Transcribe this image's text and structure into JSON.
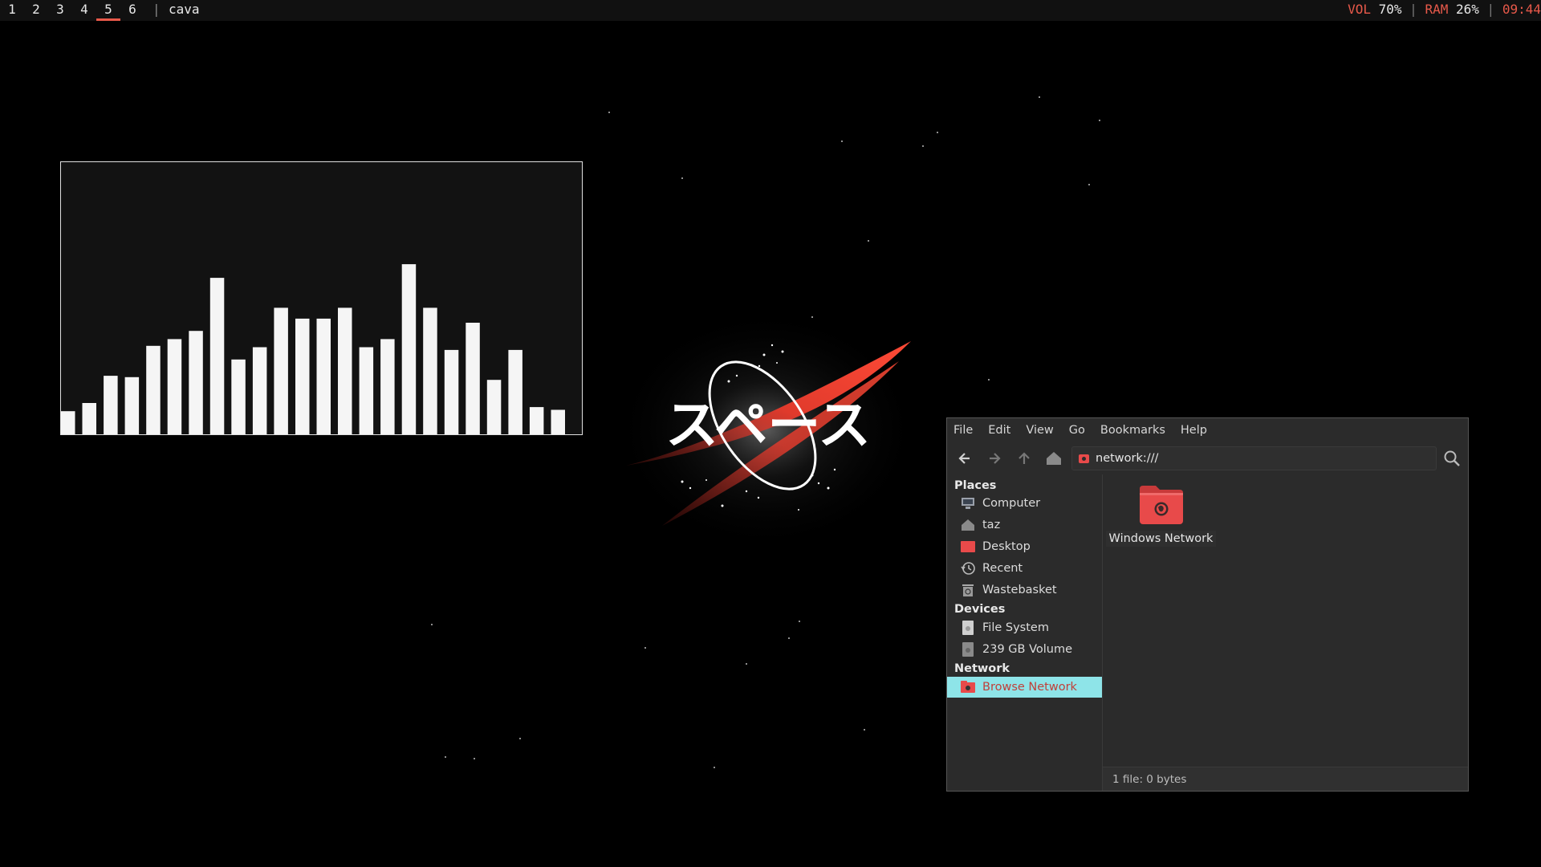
{
  "topbar": {
    "workspaces": [
      "1",
      "2",
      "3",
      "4",
      "5",
      "6"
    ],
    "active_workspace": "5",
    "separator": "|",
    "window_title": "cava",
    "status": {
      "vol_label": "VOL",
      "vol_value": "70%",
      "ram_label": "RAM",
      "ram_value": "26%",
      "sep": "|",
      "time": "09:44"
    },
    "accent_color": "#e8594a"
  },
  "wallpaper": {
    "text": "スペース"
  },
  "cava": {
    "bar_levels": [
      0.085,
      0.115,
      0.215,
      0.21,
      0.325,
      0.35,
      0.38,
      0.575,
      0.275,
      0.32,
      0.465,
      0.425,
      0.425,
      0.465,
      0.32,
      0.35,
      0.625,
      0.465,
      0.31,
      0.41,
      0.2,
      0.31,
      0.1,
      0.09
    ],
    "bar_color": "#f5f5f5"
  },
  "file_manager": {
    "menu": [
      "File",
      "Edit",
      "View",
      "Go",
      "Bookmarks",
      "Help"
    ],
    "toolbar": {
      "back_icon": "arrow-left-icon",
      "forward_icon": "arrow-right-icon",
      "up_icon": "arrow-up-icon",
      "home_icon": "home-icon",
      "search_icon": "search-icon"
    },
    "location": "network:///",
    "sidebar": {
      "places_heading": "Places",
      "places": [
        {
          "label": "Computer",
          "icon": "computer-icon"
        },
        {
          "label": "taz",
          "icon": "home-icon"
        },
        {
          "label": "Desktop",
          "icon": "desktop-icon"
        },
        {
          "label": "Recent",
          "icon": "recent-icon"
        },
        {
          "label": "Wastebasket",
          "icon": "trash-icon"
        }
      ],
      "devices_heading": "Devices",
      "devices": [
        {
          "label": "File System",
          "icon": "drive-icon"
        },
        {
          "label": "239 GB Volume",
          "icon": "drive-icon"
        }
      ],
      "network_heading": "Network",
      "network": [
        {
          "label": "Browse Network",
          "icon": "network-folder-icon",
          "selected": true
        }
      ],
      "selected_bg": "#8ee4e8"
    },
    "files": [
      {
        "label": "Windows Network",
        "icon": "network-folder-icon"
      }
    ],
    "status_text": "1 file: 0 bytes",
    "folder_color": "#e84a4a"
  }
}
